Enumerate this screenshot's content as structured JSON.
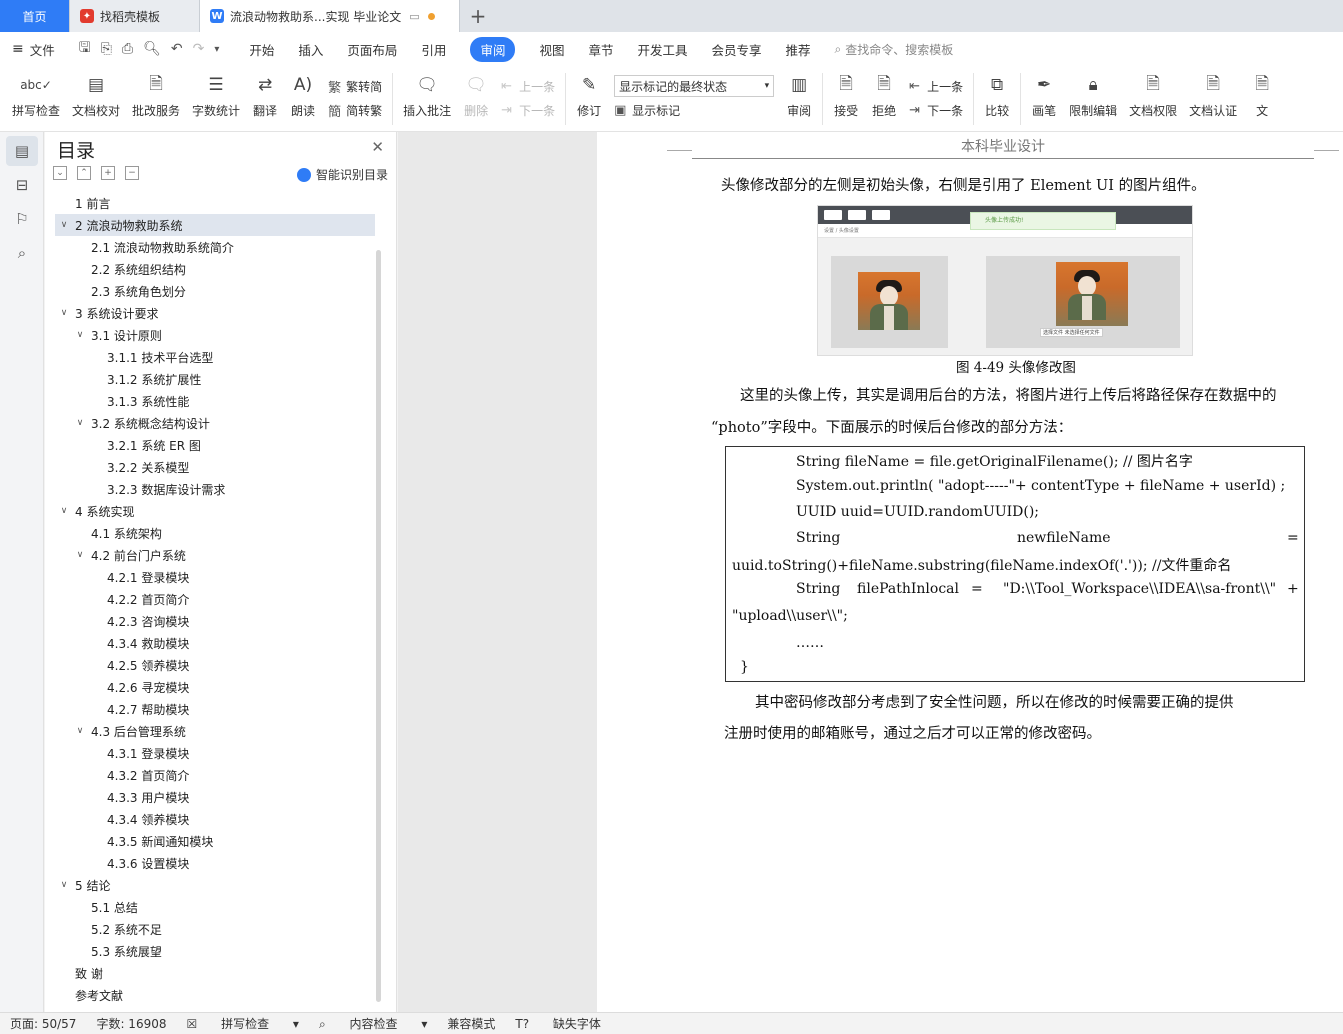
{
  "tabs": [
    {
      "label": "首页"
    },
    {
      "label": "找稻壳模板"
    },
    {
      "label": "流浪动物救助系...实现 毕业论文"
    }
  ],
  "menu": {
    "file": "文件",
    "items": [
      "开始",
      "插入",
      "页面布局",
      "引用",
      "审阅",
      "视图",
      "章节",
      "开发工具",
      "会员专享",
      "推荐"
    ],
    "search": "查找命令、搜索模板"
  },
  "ribbon": {
    "spell": "拼写检查",
    "doc_check": "文档校对",
    "batch": "批改服务",
    "count": "字数统计",
    "translate": "翻译",
    "read": "朗读",
    "to_simple": "繁转简",
    "to_trad": "简转繁",
    "insert_comment": "插入批注",
    "delete": "删除",
    "prev": "上一条",
    "next": "下一条",
    "revise": "修订",
    "markup_select": "显示标记的最终状态",
    "show_markup": "显示标记",
    "review": "审阅",
    "accept": "接受",
    "reject": "拒绝",
    "prev2": "上一条",
    "next2": "下一条",
    "compare": "比较",
    "pen": "画笔",
    "restrict": "限制编辑",
    "doc_rights": "文档权限",
    "doc_cert": "文档认证",
    "doc_more": "文"
  },
  "toc": {
    "title": "目录",
    "smart": "智能识别目录",
    "items": [
      {
        "level": 1,
        "text": "1 前言"
      },
      {
        "level": 1,
        "text": "2 流浪动物救助系统",
        "expanded": true,
        "selected": true
      },
      {
        "level": 2,
        "text": "2.1 流浪动物救助系统简介"
      },
      {
        "level": 2,
        "text": "2.2 系统组织结构"
      },
      {
        "level": 2,
        "text": "2.3 系统角色划分"
      },
      {
        "level": 1,
        "text": "3 系统设计要求",
        "expanded": true
      },
      {
        "level": 2,
        "text": "3.1 设计原则",
        "expanded": true
      },
      {
        "level": 3,
        "text": "3.1.1 技术平台选型"
      },
      {
        "level": 3,
        "text": "3.1.2 系统扩展性"
      },
      {
        "level": 3,
        "text": "3.1.3 系统性能"
      },
      {
        "level": 2,
        "text": "3.2 系统概念结构设计",
        "expanded": true
      },
      {
        "level": 3,
        "text": "3.2.1 系统 ER 图"
      },
      {
        "level": 3,
        "text": "3.2.2 关系模型"
      },
      {
        "level": 3,
        "text": "3.2.3 数据库设计需求"
      },
      {
        "level": 1,
        "text": "4 系统实现",
        "expanded": true
      },
      {
        "level": 2,
        "text": "4.1 系统架构"
      },
      {
        "level": 2,
        "text": "4.2 前台门户系统",
        "expanded": true
      },
      {
        "level": 3,
        "text": "4.2.1 登录模块"
      },
      {
        "level": 3,
        "text": "4.2.2 首页简介"
      },
      {
        "level": 3,
        "text": "4.2.3 咨询模块"
      },
      {
        "level": 3,
        "text": "4.3.4 救助模块"
      },
      {
        "level": 3,
        "text": "4.2.5 领养模块"
      },
      {
        "level": 3,
        "text": "4.2.6 寻宠模块"
      },
      {
        "level": 3,
        "text": "4.2.7 帮助模块"
      },
      {
        "level": 2,
        "text": "4.3 后台管理系统",
        "expanded": true
      },
      {
        "level": 3,
        "text": "4.3.1 登录模块"
      },
      {
        "level": 3,
        "text": "4.3.2 首页简介"
      },
      {
        "level": 3,
        "text": "4.3.3 用户模块"
      },
      {
        "level": 3,
        "text": "4.3.4 领养模块"
      },
      {
        "level": 3,
        "text": "4.3.5 新闻通知模块"
      },
      {
        "level": 3,
        "text": "4.3.6 设置模块"
      },
      {
        "level": 1,
        "text": "5 结论",
        "expanded": true
      },
      {
        "level": 2,
        "text": "5.1 总结"
      },
      {
        "level": 2,
        "text": "5.2 系统不足"
      },
      {
        "level": 2,
        "text": "5.3 系统展望"
      },
      {
        "level": 1,
        "text": "致  谢"
      },
      {
        "level": 1,
        "text": "参考文献"
      }
    ]
  },
  "doc": {
    "header": "本科毕业设计",
    "p1": "头像修改部分的左侧是初始头像，右侧是引用了 Element UI 的图片组件。",
    "fig_toast": "头像上传成功!",
    "fig_crumb": "设置  /  头像设置",
    "fig_pick": "选择文件  未选择任何文件",
    "caption": "图 4-49    头像修改图",
    "p2a": "这里的头像上传，其实是调用后台的方法，将图片进行上传后将路径保存在数据中的",
    "p2b": "“photo”字段中。下面展示的时候后台修改的部分方法：",
    "code": {
      "l1": "String fileName =    file.getOriginalFilename();       // 图片名字",
      "l2": "System.out.println( \"adopt-----\"+ contentType + fileName + userId) ;",
      "l3": "UUID uuid=UUID.randomUUID();",
      "l4a": "String",
      "l4b": "newfileName",
      "l4c": "=",
      "l5": "uuid.toString()+fileName.substring(fileName.indexOf('.')); //文件重命名",
      "l6a": "String",
      "l6b": "filePathInlocal",
      "l6c": "=",
      "l6d": "\"D:\\\\Tool_Workspace\\\\IDEA\\\\sa-front\\\\\"",
      "l6e": "+",
      "l7": "\"upload\\\\user\\\\\";",
      "l8": "……",
      "l9": "}"
    },
    "p3a": "其中密码修改部分考虑到了安全性问题，所以在修改的时候需要正确的提供",
    "p3b": "注册时使用的邮箱账号，通过之后才可以正常的修改密码。"
  },
  "status": {
    "page": "页面: 50/57",
    "words": "字数: 16908",
    "spell": "拼写检查",
    "content": "内容检查",
    "compat": "兼容模式",
    "font": "缺失字体"
  }
}
